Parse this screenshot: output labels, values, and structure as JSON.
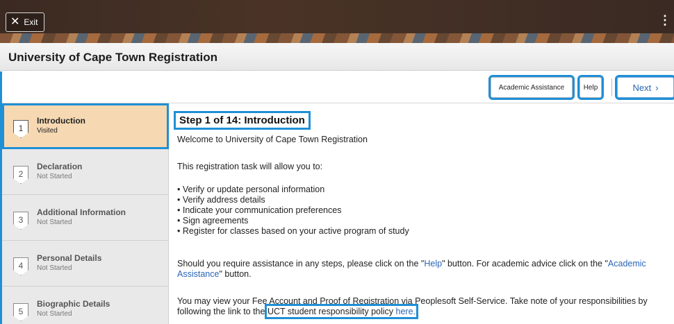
{
  "topbar": {
    "exit_label": "Exit"
  },
  "title": "University of Cape Town Registration",
  "toolbar": {
    "academic_label": "Academic Assistance",
    "help_label": "Help",
    "next_label": "Next"
  },
  "steps": [
    {
      "number": "1",
      "name": "Introduction",
      "status": "Visited"
    },
    {
      "number": "2",
      "name": "Declaration",
      "status": "Not Started"
    },
    {
      "number": "3",
      "name": "Additional Information",
      "status": "Not Started"
    },
    {
      "number": "4",
      "name": "Personal Details",
      "status": "Not Started"
    },
    {
      "number": "5",
      "name": "Biographic Details",
      "status": "Not Started"
    }
  ],
  "content": {
    "heading": "Step 1 of 14: Introduction",
    "welcome": "Welcome to University of Cape Town Registration",
    "intro": "This registration task will allow you to:",
    "bullets": [
      "Verify or update personal information",
      "Verify address details",
      "Indicate your communication preferences",
      "Sign agreements",
      "Register for classes based on your active program of study"
    ],
    "assist_1": "Should you require assistance in any steps, please click on the \"",
    "assist_help_link": "Help",
    "assist_2": "\" button. For academic advice click on the \"",
    "assist_academic_link": "Academic Assistance",
    "assist_3": "\" button.",
    "fee_1": "You may view your Fee Account and Proof of Registration via Peoplesoft Self-Service. Take note of your responsibilities by following the link to the ",
    "fee_policy": "UCT student responsibility policy ",
    "fee_here": "here."
  },
  "colors": {
    "highlight": "#1f8fd6",
    "active_step": "#f6d9b3",
    "link": "#2a65b5"
  }
}
